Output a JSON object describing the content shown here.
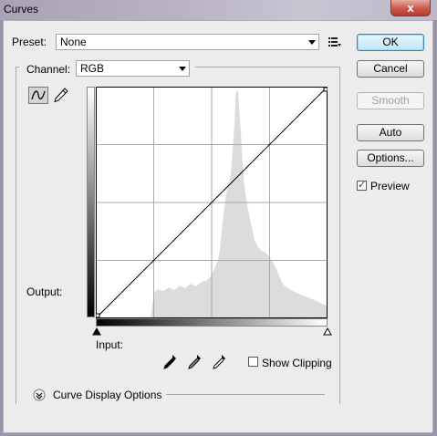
{
  "window": {
    "title": "Curves",
    "close_glyph": "x"
  },
  "preset": {
    "label": "Preset:",
    "value": "None",
    "menu_icon": "preset-options-icon"
  },
  "channel": {
    "label": "Channel:",
    "value": "RGB"
  },
  "tools": {
    "curve": "curve-points-icon",
    "pencil": "pencil-icon"
  },
  "graph": {
    "output_label": "Output:",
    "input_label": "Input:",
    "curve": "linear",
    "grid": "4x4"
  },
  "eyedroppers": [
    "black-point-eyedropper-icon",
    "gray-point-eyedropper-icon",
    "white-point-eyedropper-icon"
  ],
  "show_clipping": {
    "label": "Show Clipping",
    "checked": false
  },
  "display_options": {
    "label": "Curve Display Options",
    "icon": "expand-chevron-icon"
  },
  "buttons": {
    "ok": "OK",
    "cancel": "Cancel",
    "smooth": "Smooth",
    "auto": "Auto",
    "options": "Options..."
  },
  "preview": {
    "label": "Preview",
    "checked": true
  }
}
